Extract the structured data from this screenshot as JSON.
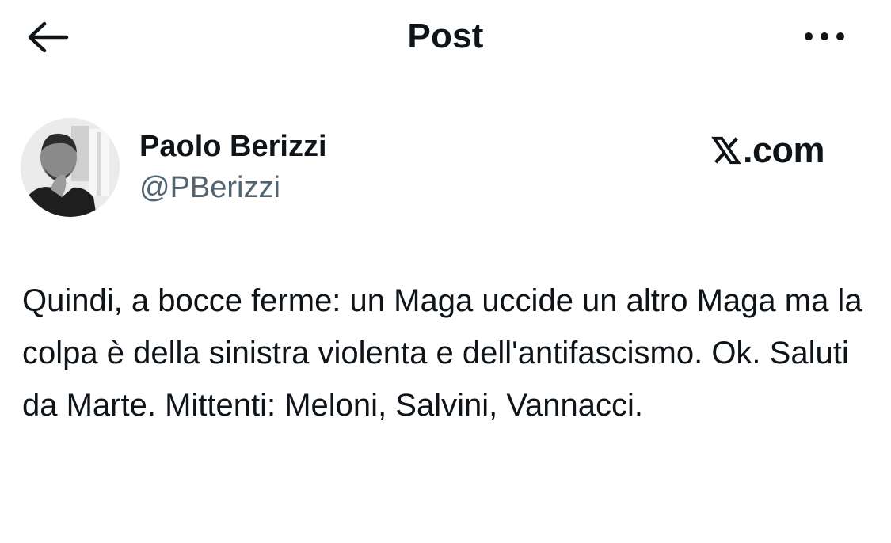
{
  "header": {
    "title": "Post",
    "back_icon": "arrow-left-icon",
    "more_icon": "more-horizontal-icon"
  },
  "author": {
    "name": "Paolo Berizzi",
    "handle": "@PBerizzi",
    "avatar_icon": "avatar-photo"
  },
  "source": {
    "logo_icon": "x-logo-icon",
    "label": ".com"
  },
  "post": {
    "text": "Quindi, a bocce ferme: un Maga uccide un altro Maga ma la colpa è della sinistra violenta e dell'antifascismo. Ok. Saluti da Marte. Mittenti: Meloni, Salvini, Vannacci."
  },
  "colors": {
    "text_primary": "#0f1419",
    "text_secondary": "#536471",
    "background": "#ffffff"
  }
}
